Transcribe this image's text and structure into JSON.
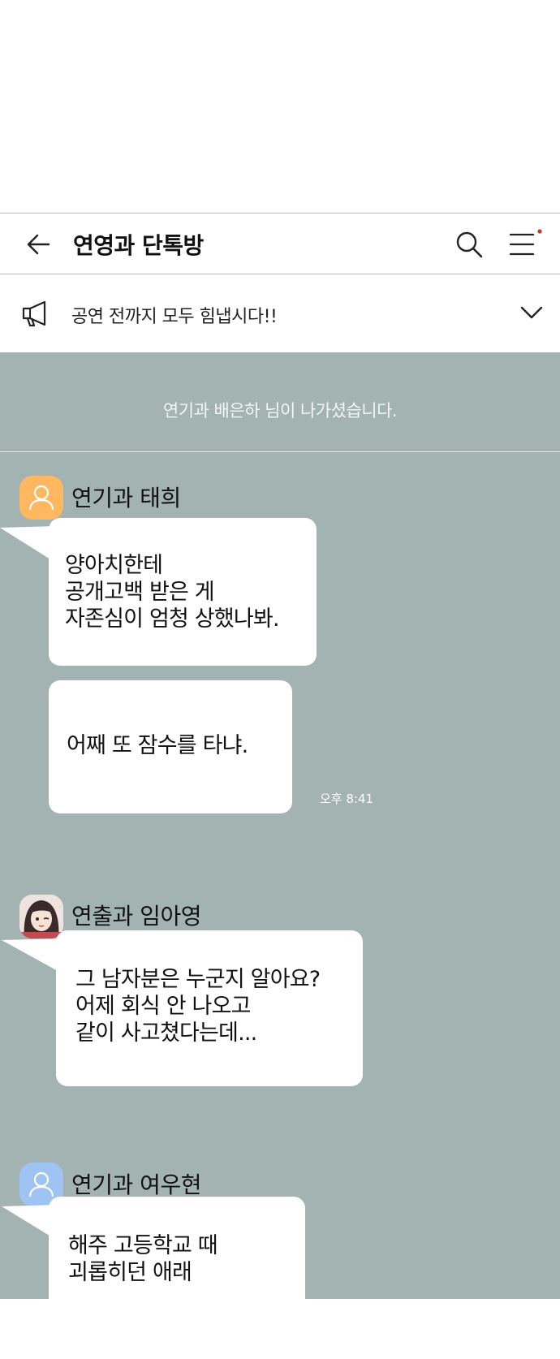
{
  "header": {
    "title": "연영과 단톡방"
  },
  "notice": {
    "text": "공연 전까지 모두 힘냅시다!!"
  },
  "chat": {
    "system_message": "연기과 배은하 님이 나가셨습니다.",
    "messages": [
      {
        "sender": "연기과 태희",
        "avatar_color": "#ffb860",
        "bubbles": [
          {
            "lines": [
              "양아치한테",
              "공개고백 받은 게",
              "자존심이 엄청 상했나봐."
            ]
          },
          {
            "lines": [
              "어째 또 잠수를 타냐."
            ],
            "time": "오후 8:41"
          }
        ]
      },
      {
        "sender": "연출과 임아영",
        "bubbles": [
          {
            "lines": [
              "그 남자분은 누군지 알아요?",
              "어제 회식 안 나오고",
              "같이 사고쳤다는데..."
            ]
          }
        ]
      },
      {
        "sender": "연기과 여우현",
        "avatar_color": "#9fc4f3",
        "bubbles": [
          {
            "lines": [
              "해주 고등학교 때",
              "괴롭히던 애래"
            ]
          }
        ]
      }
    ]
  },
  "colors": {
    "chat_background": "#a2b3b1",
    "bubble": "#ffffff",
    "notification_dot": "#c0392b"
  }
}
